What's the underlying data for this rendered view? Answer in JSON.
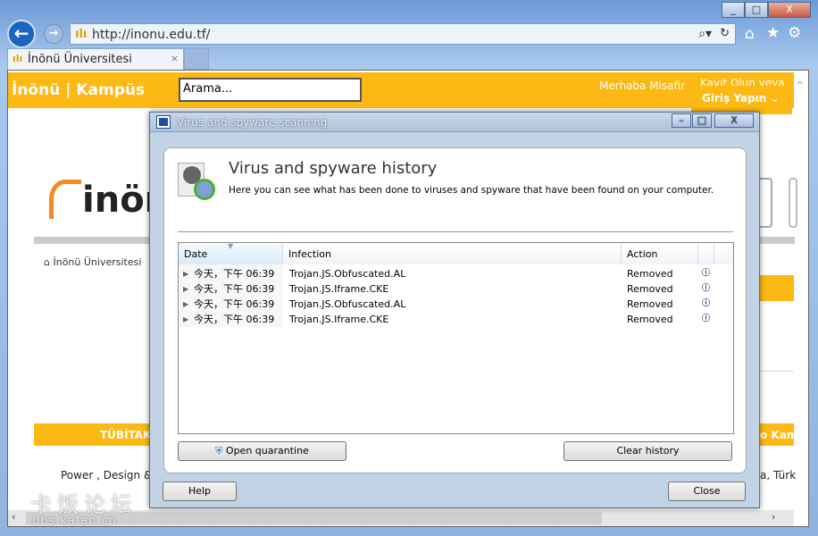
{
  "browser": {
    "url": "http://inonu.edu.tf/",
    "tab_title": "İnönü Üniversitesi",
    "window_buttons": {
      "minimize": "_",
      "maximize": "□",
      "close": "X"
    }
  },
  "site": {
    "brand": "İnönü | Kampüs",
    "search_placeholder": "Arama...",
    "greeting": "Merhaba Misafir",
    "register_partial": "Kayıt Olun veya",
    "login": "Giriş Yapın",
    "logo_text": "inönü",
    "breadcrumb": "İnönü Üniversitesi",
    "tubitak": "TÜBİTAK",
    "right_banner_partial": "o Kam",
    "footer_left": "Power , Design &",
    "footer_right": "a, Türk",
    "accent": "#fdb913"
  },
  "dialog": {
    "title": "Virus and spyware scanning",
    "heading": "Virus and spyware history",
    "description": "Here you can see what has been done to viruses and spyware that have been found on your computer.",
    "columns": [
      "Date",
      "Infection",
      "Action"
    ],
    "rows": [
      {
        "date": "今天，下午 06:39",
        "infection": "Trojan.JS.Obfuscated.AL",
        "action": "Removed"
      },
      {
        "date": "今天，下午 06:39",
        "infection": "Trojan.JS.Iframe.CKE",
        "action": "Removed"
      },
      {
        "date": "今天，下午 06:39",
        "infection": "Trojan.JS.Obfuscated.AL",
        "action": "Removed"
      },
      {
        "date": "今天，下午 06:39",
        "infection": "Trojan.JS.Iframe.CKE",
        "action": "Removed"
      }
    ],
    "open_quarantine": "Open quarantine",
    "clear_history": "Clear history",
    "help": "Help",
    "close": "Close"
  },
  "watermark": {
    "cn": "卡饭论坛",
    "url": "bbs.kafan.cn"
  }
}
